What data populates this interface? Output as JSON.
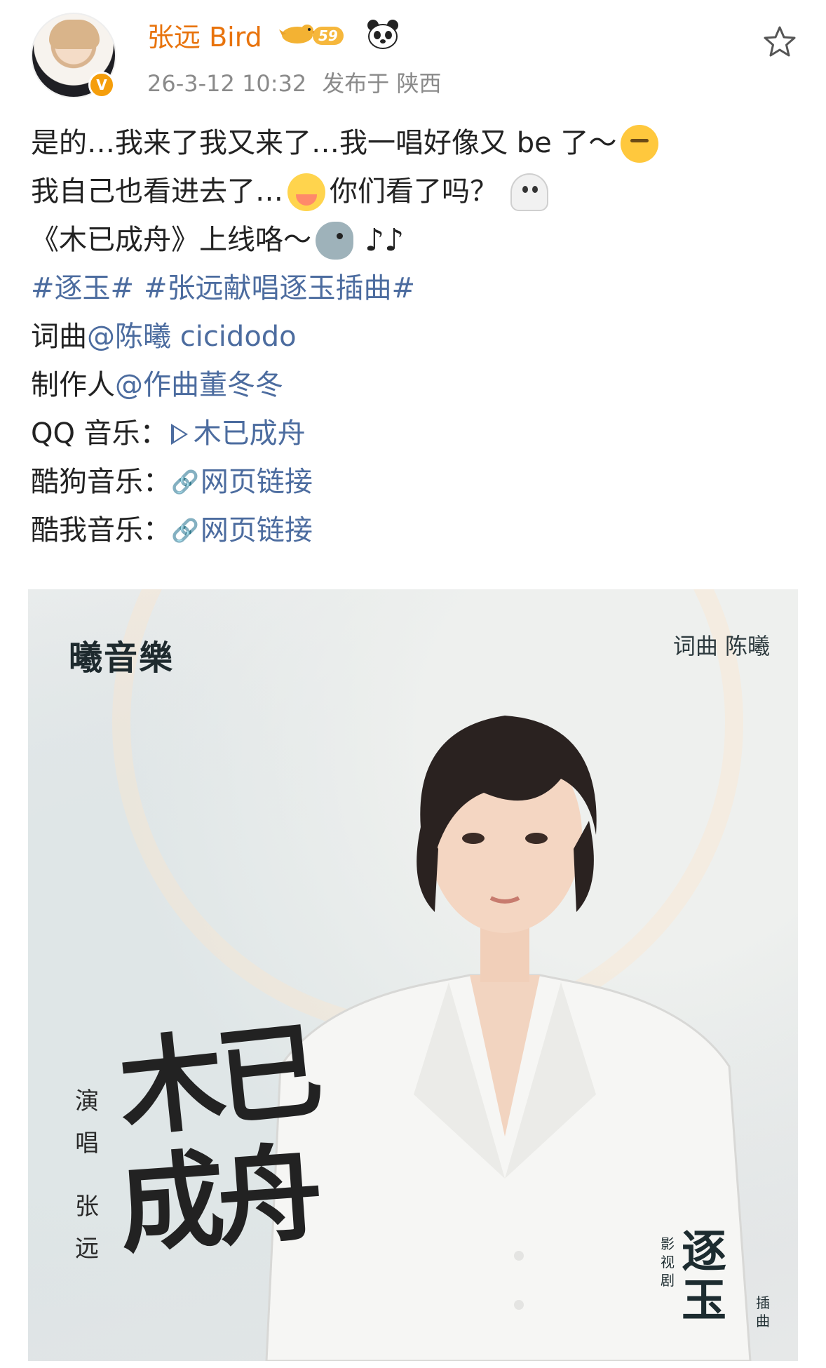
{
  "header": {
    "username": "张远 Bird",
    "vip_level": "59",
    "timestamp": "26-3-12 10:32",
    "published_from": "发布于 陕西"
  },
  "post": {
    "line1_text": "是的…我来了我又来了…我一唱好像又 be 了～",
    "line2_text_a": "我自己也看进去了…",
    "line2_text_b": "你们看了吗？",
    "line3_text": "《木已成舟》上线咯～",
    "line3_notes": "♪♪",
    "hashtag1": "#逐玉#",
    "hashtag2": "#张远献唱逐玉插曲#",
    "lyrics_label": "词曲 ",
    "lyrics_mention": "@陈曦 cicidodo",
    "producer_label": "制作人 ",
    "producer_mention": "@作曲董冬冬",
    "qq_label": "QQ 音乐：",
    "qq_link": "木已成舟",
    "kugou_label": "酷狗音乐：",
    "kugou_link": "网页链接",
    "kuwo_label": "酷我音乐：",
    "kuwo_link": "网页链接",
    "link_glyph": "🔗"
  },
  "cover": {
    "logo": "曦音樂",
    "credit": "词曲  陈曦",
    "singer_label": "演唱",
    "singer_name": "张远",
    "title_line1": "木已",
    "title_line2": "成舟",
    "drama_label": "影视剧",
    "drama_name": "逐玉",
    "drama_suffix": "插曲"
  },
  "colors": {
    "username": "#e8730c",
    "link": "#4c6c9f",
    "meta": "#8a8a8a"
  },
  "icons": [
    "verified-badge-icon",
    "vip-bird-icon",
    "panda-icon",
    "star-icon",
    "think-emoji",
    "cry-emoji",
    "ghost-emoji",
    "bird-emoji",
    "play-icon",
    "link-icon"
  ]
}
